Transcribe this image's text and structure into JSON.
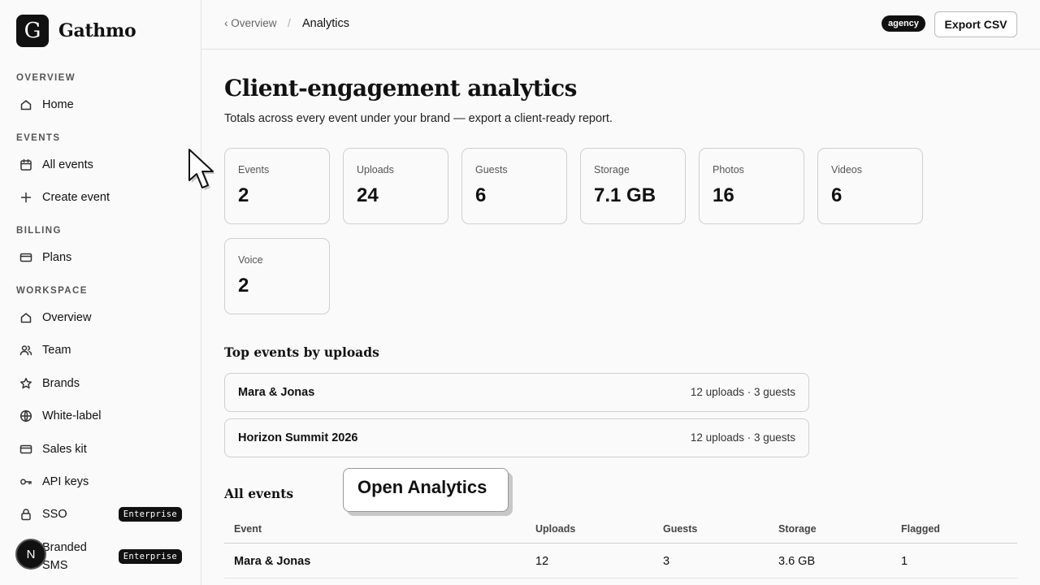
{
  "app": {
    "brand_letter": "G",
    "brand_name": "Gathmo"
  },
  "sidebar": {
    "sections": [
      {
        "label": "OVERVIEW"
      },
      {
        "label": "EVENTS"
      },
      {
        "label": "BILLING"
      },
      {
        "label": "WORKSPACE"
      }
    ],
    "items": [
      {
        "label": "Home",
        "icon": "home-icon"
      },
      {
        "label": "All events",
        "icon": "calendar-icon"
      },
      {
        "label": "Create event",
        "icon": "plus-icon"
      },
      {
        "label": "Plans",
        "icon": "card-icon"
      },
      {
        "label": "Overview",
        "icon": "home-icon"
      },
      {
        "label": "Team",
        "icon": "users-icon"
      },
      {
        "label": "Brands",
        "icon": "star-icon"
      },
      {
        "label": "White-label",
        "icon": "globe-icon"
      },
      {
        "label": "Sales kit",
        "icon": "card-icon"
      },
      {
        "label": "API keys",
        "icon": "key-icon"
      },
      {
        "label": "SSO",
        "icon": "lock-icon",
        "badge": "Enterprise"
      },
      {
        "label_line1": "Branded",
        "label_line2": "SMS",
        "icon": "chat-icon",
        "badge": "Enterprise"
      }
    ],
    "avatar_initial": "N"
  },
  "header": {
    "breadcrumb_back": "‹ Overview",
    "breadcrumb_separator": "/",
    "breadcrumb_current": "Analytics",
    "tier_badge": "agency",
    "export_button": "Export CSV"
  },
  "main": {
    "title": "Client-engagement analytics",
    "subtitle": "Totals across every event under your brand — export a client-ready report.",
    "stats": [
      {
        "label": "Events",
        "value": "2"
      },
      {
        "label": "Uploads",
        "value": "24"
      },
      {
        "label": "Guests",
        "value": "6"
      },
      {
        "label": "Storage",
        "value": "7.1 GB"
      },
      {
        "label": "Photos",
        "value": "16"
      },
      {
        "label": "Videos",
        "value": "6"
      },
      {
        "label": "Voice",
        "value": "2"
      }
    ],
    "top_events_title": "Top events by uploads",
    "top_events": [
      {
        "name": "Mara & Jonas",
        "meta": "12 uploads · 3 guests"
      },
      {
        "name": "Horizon Summit 2026",
        "meta": "12 uploads · 3 guests"
      }
    ],
    "all_events_title": "All events",
    "table": {
      "headers": [
        "Event",
        "Uploads",
        "Guests",
        "Storage",
        "Flagged"
      ],
      "rows": [
        [
          "Mara & Jonas",
          "12",
          "3",
          "3.6 GB",
          "1"
        ]
      ]
    }
  },
  "tooltip": {
    "text": "Open Analytics"
  }
}
